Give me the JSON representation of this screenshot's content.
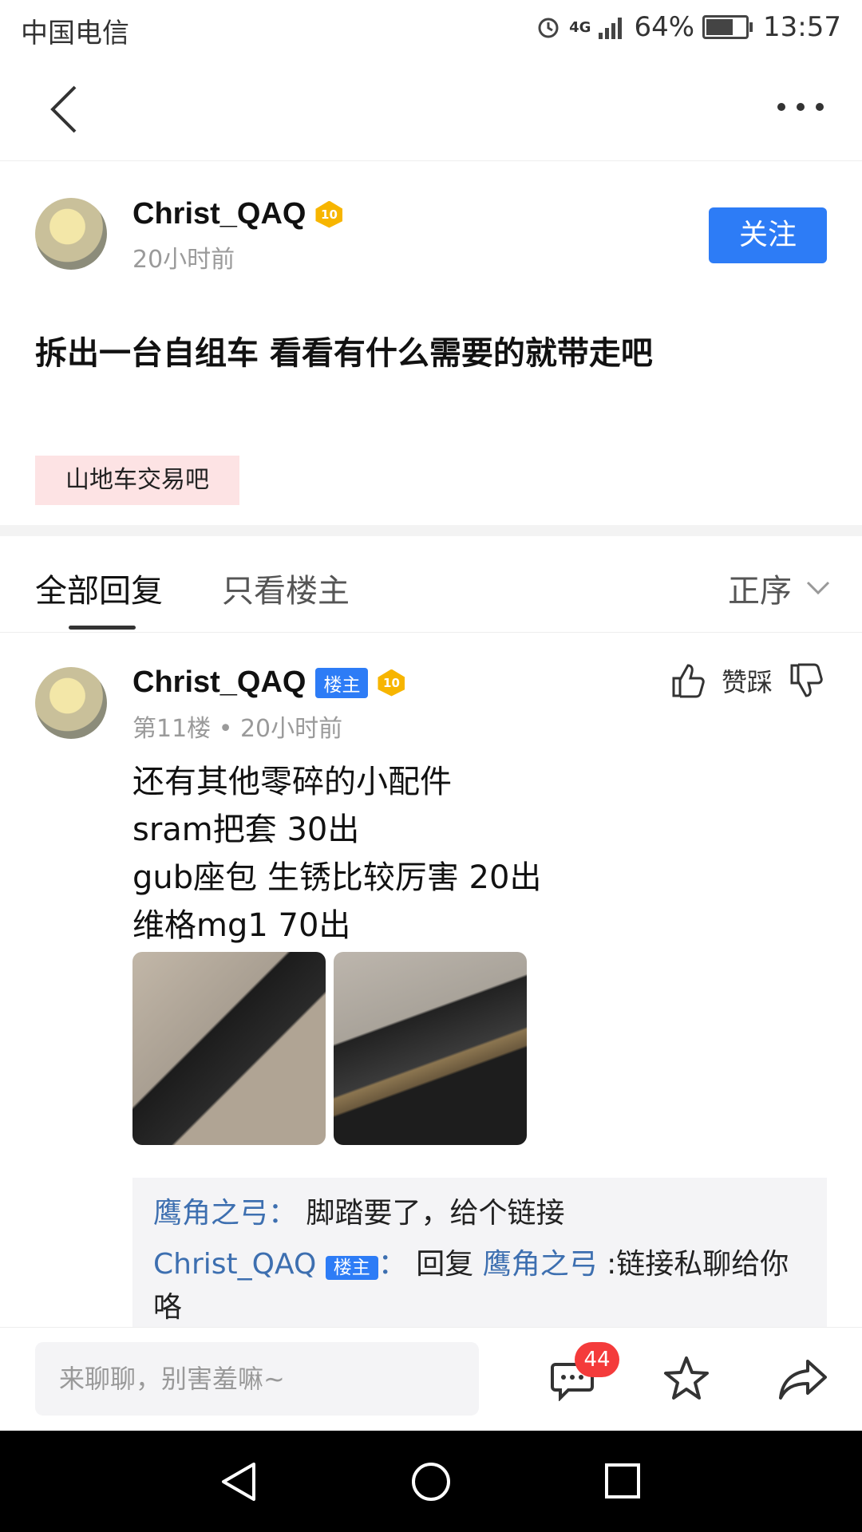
{
  "status_bar": {
    "carrier": "中国电信",
    "network": "4G",
    "battery": "64%",
    "time": "13:57"
  },
  "post": {
    "author": "Christ_QAQ",
    "level": "10",
    "time": "20小时前",
    "follow_label": "关注",
    "title": "拆出一台自组车 看看有什么需要的就带走吧",
    "forum_tag": "山地车交易吧"
  },
  "tabs": {
    "all": "全部回复",
    "op_only": "只看楼主",
    "sort": "正序"
  },
  "reply": {
    "author": "Christ_QAQ",
    "op_badge": "楼主",
    "level": "10",
    "meta": "第11楼 • 20小时前",
    "vote_label": "赞踩",
    "lines": [
      "还有其他零碎的小配件",
      "sram把套 30出",
      "gub座包 生锈比较厉害 20出",
      "维格mg1 70出"
    ],
    "sub_replies": [
      {
        "user": "鹰角之弓",
        "sep": "：",
        "text": "脚踏要了，给个链接"
      },
      {
        "user": "Christ_QAQ",
        "op_badge": "楼主",
        "sep": "：",
        "prefix": "回复",
        "reply_to": "鹰角之弓",
        "text": ":链接私聊给你咯"
      }
    ]
  },
  "bottom": {
    "placeholder": "来聊聊，别害羞嘛~",
    "comment_count": "44"
  },
  "icons": [
    "back-icon",
    "more-icon",
    "alarm-icon",
    "signal-icon",
    "battery-icon",
    "level-badge-icon",
    "chevron-down-icon",
    "thumb-up-icon",
    "thumb-down-icon",
    "comment-icon",
    "star-icon",
    "share-icon",
    "nav-back-icon",
    "nav-home-icon",
    "nav-recent-icon"
  ]
}
